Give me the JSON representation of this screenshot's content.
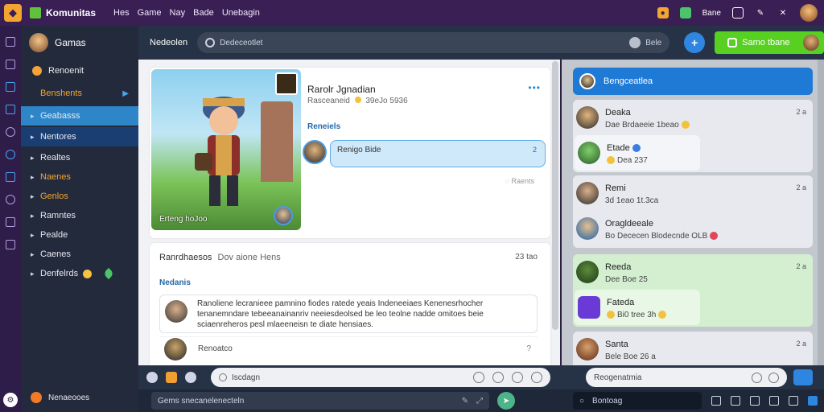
{
  "topbar": {
    "brand": "Komunitas",
    "nav": [
      "Hes",
      "Game",
      "Nay",
      "Bade",
      "Unebagin"
    ],
    "right_label": "Bane"
  },
  "sidebar": {
    "user": "Gamas",
    "recent_label": "Renoenit",
    "items": [
      {
        "label": "Benshents",
        "style": "orange"
      },
      {
        "label": "Geabasss",
        "style": "active-blue"
      },
      {
        "label": "Nentores",
        "style": "active-dark"
      },
      {
        "label": "Realtes",
        "style": ""
      },
      {
        "label": "Naenes",
        "style": "orange"
      },
      {
        "label": "Genlos",
        "style": "orange"
      },
      {
        "label": "Ramntes",
        "style": ""
      },
      {
        "label": "Pealde",
        "style": ""
      },
      {
        "label": "Caenes",
        "style": ""
      },
      {
        "label": "Denfelrds",
        "style": ""
      }
    ],
    "footer": "Nenaeooes"
  },
  "search": {
    "label": "Nedeolen",
    "placeholder": "Dedeceotlet",
    "right_text": "Bele",
    "game_button": "Samo tbane"
  },
  "feed": {
    "post1": {
      "title": "Rarolr Jgnadian",
      "subtitle": "Rasceaneid",
      "subtitle_rest": "39eJo 5936",
      "hero_caption": "Erteng  hoJoo",
      "section": "Reneiels",
      "bubble_text": "Renigo Bide",
      "bubble_time": "2",
      "meta": "Raents"
    },
    "post2": {
      "title": "Ranrdhaesos",
      "title_rest": "Dov    aione Hens",
      "time": "23 tao",
      "section": "Nedanis",
      "comment": "Ranoliene lecranieee pamnino fiodes ratede yeais Indeneeiaes Kenenesrhocher tenanemndare tebeeanainanriv neeiesdeolsed be leo teolne nadde omitoes beie sciaenreheros pesl mlaeeneisn te diate hensiaes.",
      "reply": "Renoatco",
      "reply_mark": "?"
    }
  },
  "composer": {
    "placeholder": "Iscdagn",
    "secondary": "Gems snecanelenecteln"
  },
  "chat": {
    "header": "Bengceatlea",
    "messages": [
      {
        "name": "Deaka",
        "text": "Dae Brdaeeie 1beao",
        "time": "2 a"
      },
      {
        "name": "Etade",
        "text": "Dea 237",
        "time": "",
        "inner": true
      },
      {
        "name": "Remi",
        "text": "3d 1eao 1t.3ca",
        "time": "2 a"
      },
      {
        "name": "Oragldeeale",
        "text": "Bo Dececen Blodecnde OLB",
        "time": ""
      },
      {
        "name": "Reeda",
        "text": "Dee Boe 25",
        "time": "2 a"
      },
      {
        "name": "Fateda",
        "text": "Bi0 tree 3h",
        "time": "",
        "inner": true
      },
      {
        "name": "Santa",
        "text": "Bele Boe 26 a",
        "time": "2 a"
      }
    ],
    "composer": "Reogenatmia",
    "footer": "Bontoag"
  }
}
